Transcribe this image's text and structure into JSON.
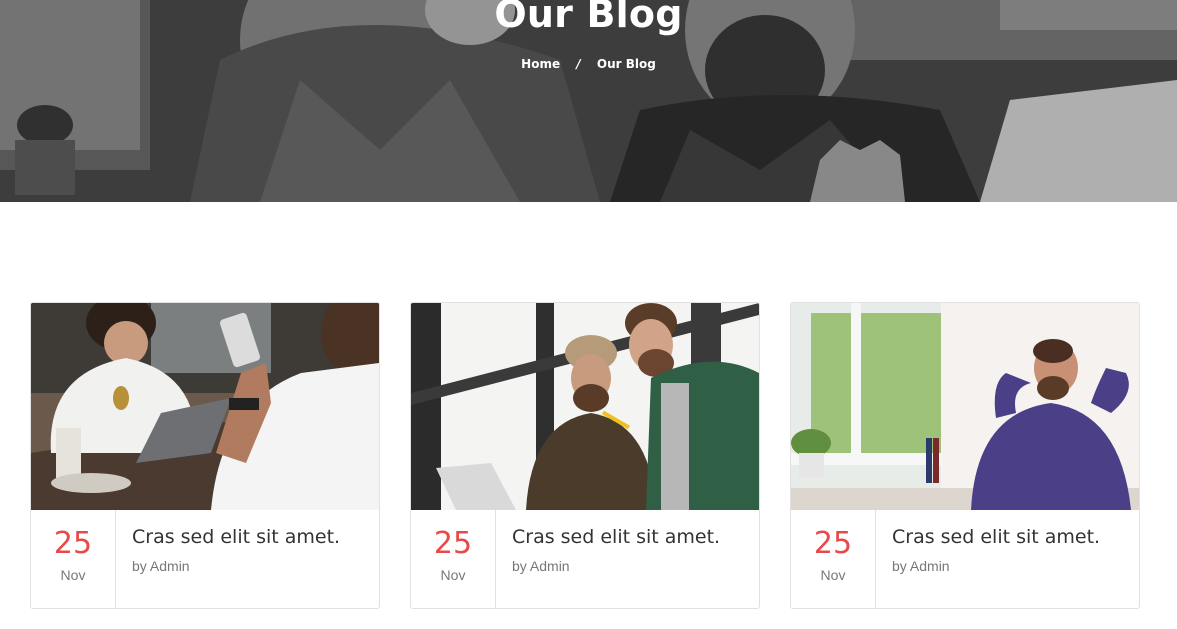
{
  "hero": {
    "title": "Our Blog",
    "breadcrumb": {
      "home": "Home",
      "separator": "/",
      "current": "Our Blog"
    }
  },
  "posts": [
    {
      "day": "25",
      "month": "Nov",
      "title": "Cras sed elit sit amet.",
      "author": "by Admin",
      "image": "cafe-meeting-photo"
    },
    {
      "day": "25",
      "month": "Nov",
      "title": "Cras sed elit sit amet.",
      "author": "by Admin",
      "image": "two-men-laptop-photo"
    },
    {
      "day": "25",
      "month": "Nov",
      "title": "Cras sed elit sit amet.",
      "author": "by Admin",
      "image": "man-relaxing-photo"
    }
  ],
  "colors": {
    "accent": "#e84a4a",
    "border": "#e1e1e1",
    "text": "#333333",
    "muted": "#777777"
  }
}
